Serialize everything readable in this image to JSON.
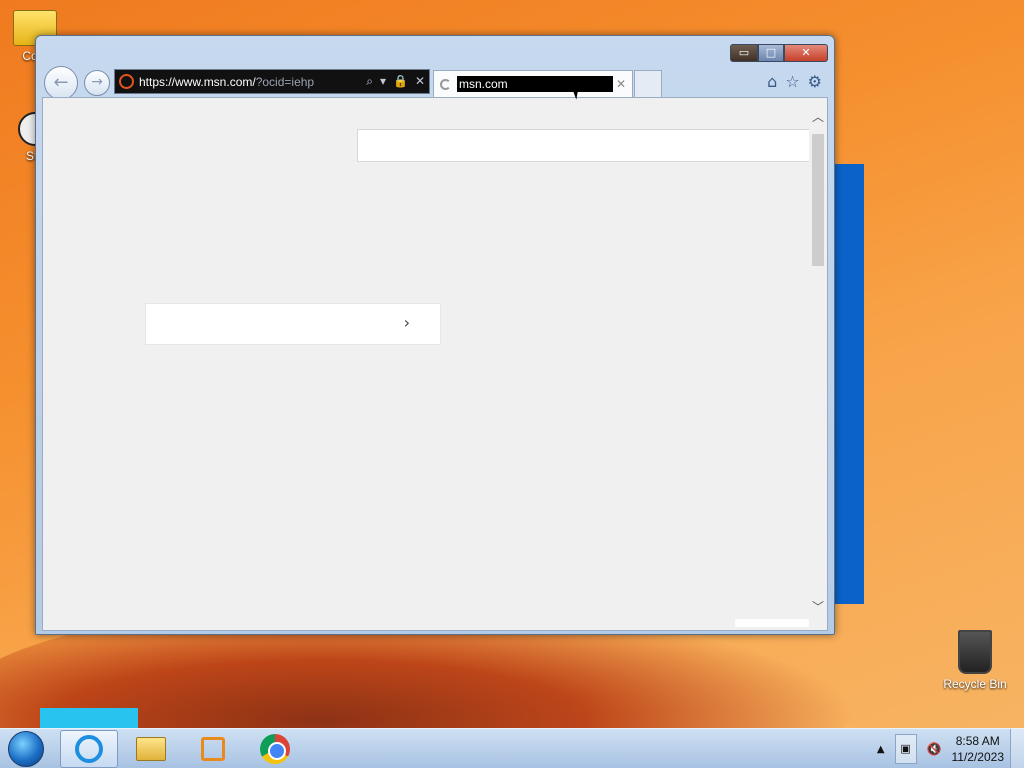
{
  "desktop": {
    "icons": [
      {
        "label": "Com",
        "icon": "computer-icon"
      },
      {
        "label": "Ste",
        "icon": "steam-icon"
      },
      {
        "label": "Recycle Bin",
        "icon": "recycle-bin-icon"
      }
    ]
  },
  "browser": {
    "window_controls": {
      "minimize": "▭",
      "maximize": "□",
      "close": "✕"
    },
    "address": {
      "scheme_host": "https://www.msn.com/",
      "path": "?ocid=iehp"
    },
    "tab": {
      "title": "msn.com",
      "close": "✕"
    },
    "toolbar_icons": [
      "home-icon",
      "favorites-star-icon",
      "settings-gear-icon"
    ],
    "nav": {
      "back": "←",
      "forward": "→"
    },
    "scrollbar": {
      "up": "︿",
      "down": "﹀"
    }
  },
  "taskbar": {
    "pinned": [
      "internet-explorer-icon",
      "file-explorer-icon",
      "media-player-icon",
      "chrome-icon"
    ],
    "clock": {
      "time": "8:58 AM",
      "date": "11/2/2023"
    }
  },
  "colors": {
    "accent": "#0b63c9",
    "desktop": "#f5902f"
  }
}
